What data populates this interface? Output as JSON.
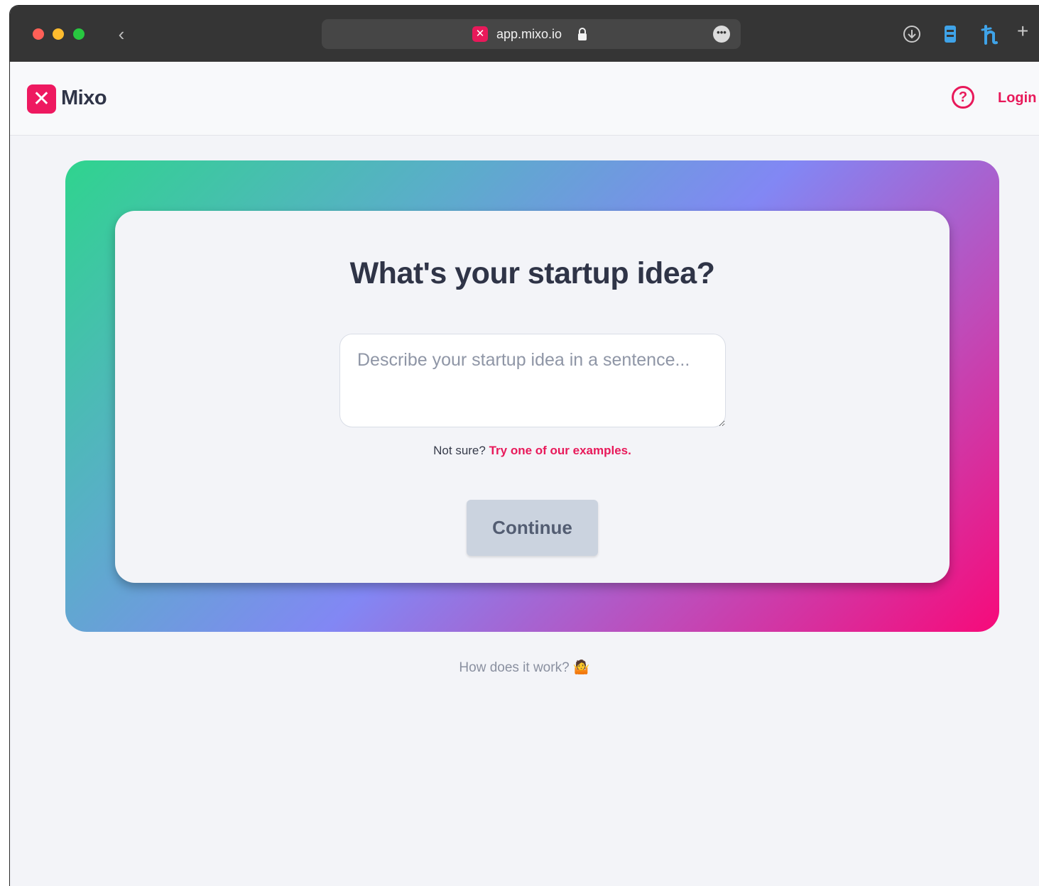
{
  "browser": {
    "url": "app.mixo.io",
    "favicon_glyph": "✕",
    "more_glyph": "•••",
    "back_glyph": "‹",
    "new_tab_glyph": "+"
  },
  "header": {
    "logo_glyph": "✕",
    "brand_name": "Mixo",
    "help_glyph": "?",
    "login_label": "Login"
  },
  "main": {
    "title": "What's your startup idea?",
    "input": {
      "value": "",
      "placeholder": "Describe your startup idea in a sentence..."
    },
    "hint_prefix": "Not sure?",
    "hint_link": "Try one of our examples.",
    "continue_label": "Continue"
  },
  "footer": {
    "how_label": "How does it work?",
    "how_emoji": "🤷"
  },
  "colors": {
    "brand": "#e8195a",
    "gradient_start": "#2fd48e",
    "gradient_mid": "#8287f4",
    "gradient_end": "#f70a7a",
    "button_disabled": "#cbd3df"
  }
}
